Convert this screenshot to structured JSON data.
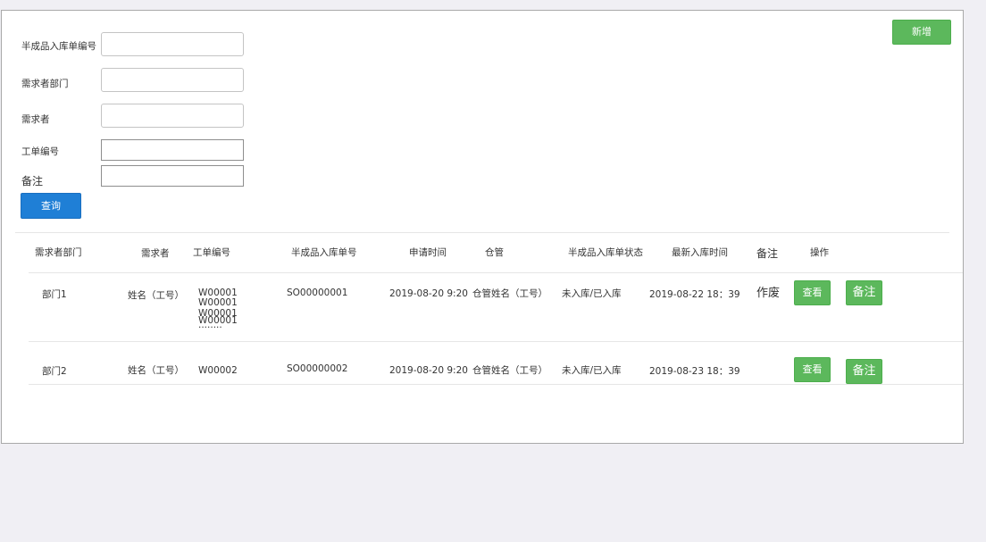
{
  "toolbar": {
    "new_label": "新增"
  },
  "filters": {
    "semi_no_label": "半成品入库单编号",
    "dept_label": "需求者部门",
    "requester_label": "需求者",
    "workorder_label": "工单编号",
    "remark_label": "备注",
    "semi_no_value": "",
    "dept_value": "",
    "requester_value": "",
    "workorder_value": "",
    "remark_value": "",
    "query_label": "查询"
  },
  "table": {
    "headers": {
      "dept": "需求者部门",
      "requester": "需求者",
      "workorder": "工单编号",
      "semi_no": "半成品入库单号",
      "apply_time": "申请时间",
      "warehouse": "仓管",
      "status": "半成品入库单状态",
      "latest_time": "最新入库时间",
      "remark": "备注",
      "action": "操作"
    },
    "rows": [
      {
        "dept": "部门1",
        "requester": "姓名（工号）",
        "workorders": [
          "W00001",
          "W00001",
          "W00001",
          "W00001",
          "········"
        ],
        "semi_no": "SO00000001",
        "apply_time": "2019-08-20 9:20",
        "warehouse": "仓管姓名（工号）",
        "status": "未入库/已入库",
        "latest_time": "2019-08-22 18：39",
        "remark": "作废",
        "view_label": "查看",
        "note_label": "备注"
      },
      {
        "dept": "部门2",
        "requester": "姓名（工号）",
        "workorders": [
          "W00002"
        ],
        "semi_no": "SO00000002",
        "apply_time": "2019-08-20 9:20",
        "warehouse": "仓管姓名（工号）",
        "status": "未入库/已入库",
        "latest_time": "2019-08-23 18：39",
        "remark": "",
        "view_label": "查看",
        "note_label": "备注"
      }
    ]
  }
}
